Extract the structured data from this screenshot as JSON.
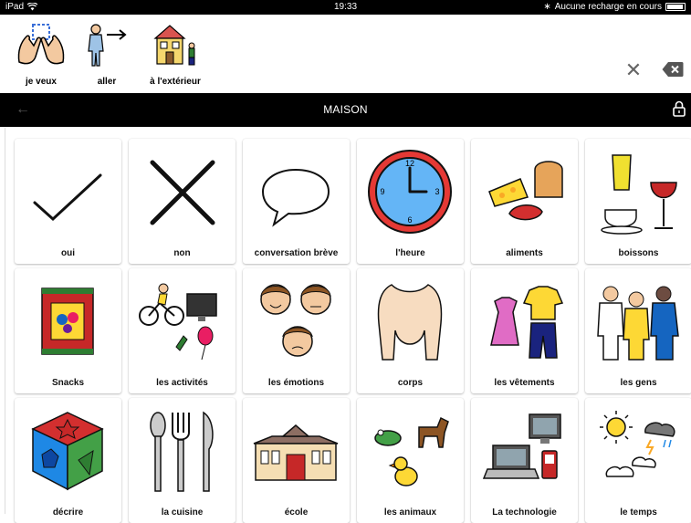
{
  "status": {
    "device": "iPad",
    "time": "19:33",
    "charging": "Aucune recharge en cours"
  },
  "sentence": [
    {
      "label": "je veux"
    },
    {
      "label": "aller"
    },
    {
      "label": "à l'extérieur"
    }
  ],
  "nav": {
    "title": "MAISON",
    "back_icon": "back-arrow-icon",
    "lock_icon": "lock-icon",
    "clear_icon": "close-icon",
    "backspace_icon": "backspace-icon"
  },
  "tiles": [
    {
      "label": "oui"
    },
    {
      "label": "non"
    },
    {
      "label": "conversation brève"
    },
    {
      "label": "l'heure"
    },
    {
      "label": "aliments"
    },
    {
      "label": "boissons"
    },
    {
      "label": "Snacks"
    },
    {
      "label": "les activités"
    },
    {
      "label": "les émotions"
    },
    {
      "label": "corps"
    },
    {
      "label": "les vêtements"
    },
    {
      "label": "les gens"
    },
    {
      "label": "décrire"
    },
    {
      "label": "la cuisine"
    },
    {
      "label": "école"
    },
    {
      "label": "les animaux"
    },
    {
      "label": "La technologie"
    },
    {
      "label": "le temps"
    }
  ]
}
